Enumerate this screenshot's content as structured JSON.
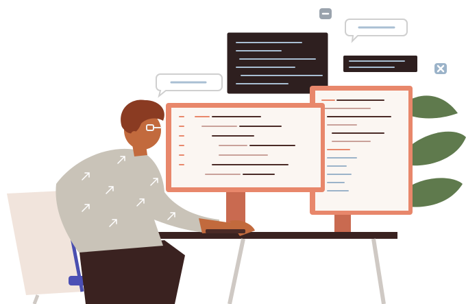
{
  "illustration": {
    "subject": "developer-at-dual-monitor-desk",
    "colors": {
      "background": "#ffffff",
      "monitor_frame": "#e8876b",
      "monitor_frame_dark": "#c96a50",
      "screen": "#fbf6f2",
      "code_dark": "#4a2a26",
      "code_mid": "#c9a19a",
      "code_blue": "#9bb3c9",
      "code_orange": "#e8876b",
      "dark_panel": "#2e1f1f",
      "bubble_fill": "#ffffff",
      "bubble_outline": "#cfcfcf",
      "bubble_line": "#a9bfd3",
      "shirt": "#c9c3b8",
      "shirt_arrow": "#ffffff",
      "hair": "#8a3b22",
      "skin": "#c26a3d",
      "glasses": "#f2f2f2",
      "pants": "#3a2220",
      "chair": "#f1e4dc",
      "chair_back_edge": "#4a4fb0",
      "seat": "#4b4fb5",
      "desk": "#3a2220",
      "desk_legs": "#cfc9c4",
      "plant_leaf": "#5f7a4d",
      "plant_leaf_light": "#7a9463",
      "badge_grey": "#9aa3ad",
      "badge_blue": "#9bb3c9"
    },
    "icons": [
      "minus-badge-icon",
      "close-badge-icon"
    ]
  }
}
